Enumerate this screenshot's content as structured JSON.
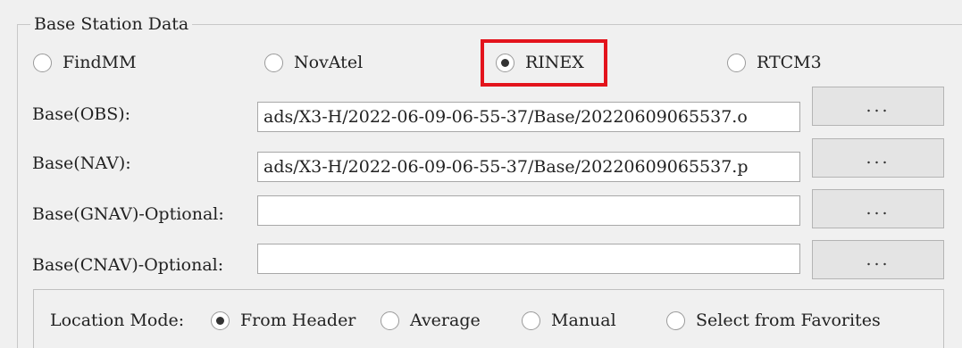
{
  "group": {
    "title": "Base Station Data"
  },
  "format_options": [
    {
      "label": "FindMM",
      "checked": false
    },
    {
      "label": "NovAtel",
      "checked": false
    },
    {
      "label": "RINEX",
      "checked": true
    },
    {
      "label": "RTCM3",
      "checked": false
    }
  ],
  "files": [
    {
      "label": "Base(OBS):",
      "value": "ads/X3-H/2022-06-09-06-55-37/Base/20220609065537.o",
      "button": "..."
    },
    {
      "label": "Base(NAV):",
      "value": "ads/X3-H/2022-06-09-06-55-37/Base/20220609065537.p",
      "button": "..."
    },
    {
      "label": "Base(GNAV)-Optional:",
      "value": "",
      "button": "..."
    },
    {
      "label": "Base(CNAV)-Optional:",
      "value": "",
      "button": "..."
    }
  ],
  "location": {
    "label": "Location Mode:",
    "options": [
      {
        "label": "From Header",
        "checked": true
      },
      {
        "label": "Average",
        "checked": false
      },
      {
        "label": "Manual",
        "checked": false
      },
      {
        "label": "Select from Favorites",
        "checked": false
      }
    ]
  },
  "highlight_color": "#e3141c"
}
